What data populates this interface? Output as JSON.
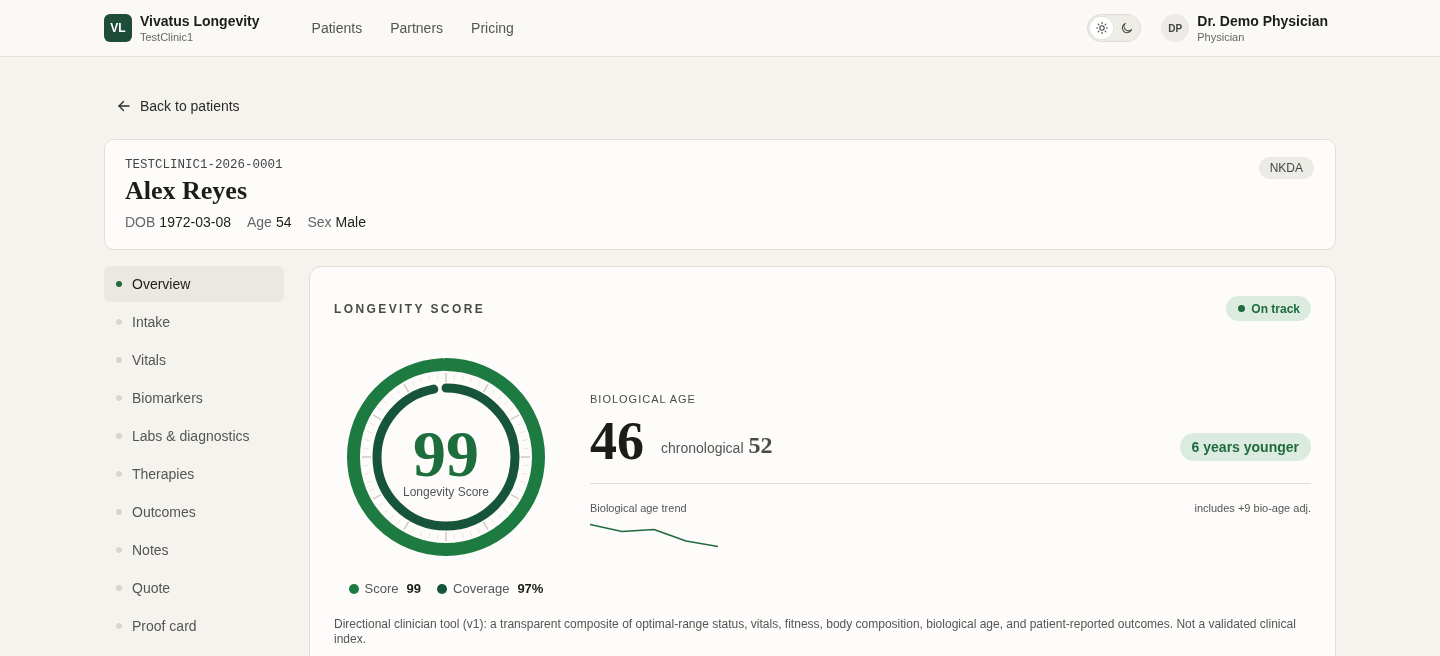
{
  "header": {
    "logo": "VL",
    "brand": "Vivatus Longevity",
    "clinic": "TestClinic1",
    "nav": [
      "Patients",
      "Partners",
      "Pricing"
    ],
    "theme_toggle": [
      {
        "kind": "light",
        "selected": true
      },
      {
        "kind": "dark",
        "selected": false
      }
    ],
    "user": {
      "initials": "DP",
      "name": "Dr. Demo Physician",
      "role": "Physician"
    }
  },
  "back_link": {
    "label": "Back to patients"
  },
  "patient": {
    "id": "TESTCLINIC1-2026-0001",
    "name": "Alex Reyes",
    "fields": [
      {
        "label": "DOB",
        "value": "1972-03-08"
      },
      {
        "label": "Age",
        "value": "54"
      },
      {
        "label": "Sex",
        "value": "Male"
      }
    ],
    "badge": "NKDA"
  },
  "sidebar": {
    "items": [
      {
        "label": "Overview",
        "selected": true
      },
      {
        "label": "Intake",
        "selected": false
      },
      {
        "label": "Vitals",
        "selected": false
      },
      {
        "label": "Biomarkers",
        "selected": false
      },
      {
        "label": "Labs & diagnostics",
        "selected": false
      },
      {
        "label": "Therapies",
        "selected": false
      },
      {
        "label": "Outcomes",
        "selected": false
      },
      {
        "label": "Notes",
        "selected": false
      },
      {
        "label": "Quote",
        "selected": false
      },
      {
        "label": "Proof card",
        "selected": false
      }
    ]
  },
  "score_card": {
    "title": "LONGEVITY SCORE",
    "status": "On track",
    "gauge": {
      "value": "99",
      "label": "Longevity Score",
      "rings": [
        {
          "name": "Score",
          "value": "99",
          "level": 0.99,
          "color": "#1d7a40"
        },
        {
          "name": "Coverage",
          "value": "97%",
          "level": 0.97,
          "color": "#17553a"
        }
      ]
    },
    "biological_age": {
      "title": "BIOLOGICAL AGE",
      "value": "46",
      "chronological_label": "chronological",
      "chronological_value": "52",
      "difference": "6 years younger",
      "trend_label": "Biological age trend",
      "adjustment": "includes +9 bio-age adj."
    },
    "note": "Directional clinician tool (v1): a transparent composite of optimal-range status, vitals, fitness, body composition, biological age, and patient-reported outcomes. Not a validated clinical index."
  }
}
